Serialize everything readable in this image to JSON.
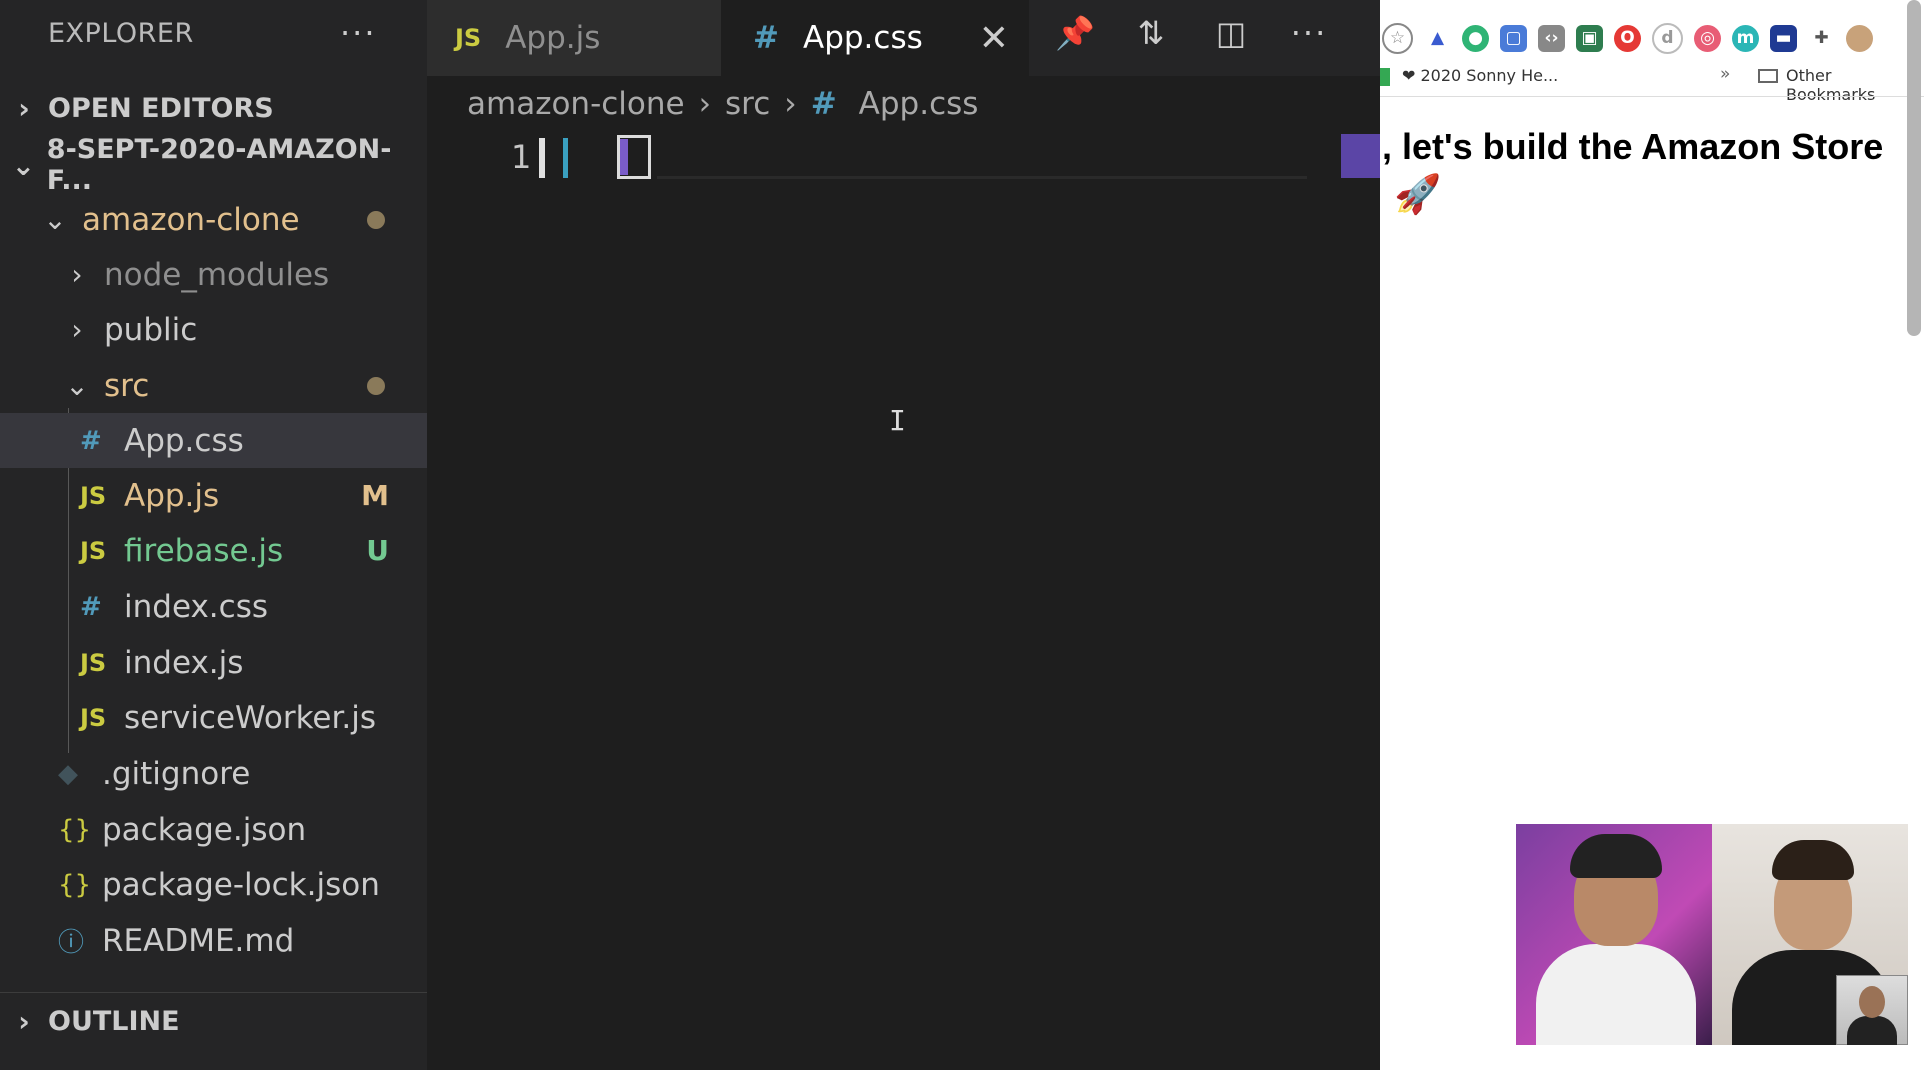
{
  "sidebar": {
    "title": "EXPLORER",
    "more": "···",
    "open_editors": "OPEN EDITORS",
    "project": "8-SEPT-2020-AMAZON-F...",
    "tree": [
      {
        "label": "amazon-clone",
        "type": "folder-open",
        "color": "#e2c08d"
      },
      {
        "label": "node_modules",
        "type": "folder",
        "color": "#8f8f8f"
      },
      {
        "label": "public",
        "type": "folder",
        "color": "#cccccc"
      },
      {
        "label": "src",
        "type": "folder-open",
        "color": "#e2c08d"
      },
      {
        "label": "App.css",
        "type": "css",
        "color": "#cccccc"
      },
      {
        "label": "App.js",
        "type": "js",
        "color": "#e2c08d",
        "badge": "M"
      },
      {
        "label": "firebase.js",
        "type": "js",
        "color": "#73c991",
        "badge": "U"
      },
      {
        "label": "index.css",
        "type": "css",
        "color": "#cccccc"
      },
      {
        "label": "index.js",
        "type": "js",
        "color": "#cccccc"
      },
      {
        "label": "serviceWorker.js",
        "type": "js",
        "color": "#cccccc"
      },
      {
        "label": ".gitignore",
        "type": "git",
        "color": "#cccccc"
      },
      {
        "label": "package.json",
        "type": "json",
        "color": "#cccccc"
      },
      {
        "label": "package-lock.json",
        "type": "json",
        "color": "#cccccc"
      },
      {
        "label": "README.md",
        "type": "info",
        "color": "#cccccc"
      }
    ],
    "outline": "OUTLINE"
  },
  "editor": {
    "tabs": [
      {
        "label": "App.js",
        "icon": "JS",
        "active": false
      },
      {
        "label": "App.css",
        "icon": "#",
        "active": true
      }
    ],
    "breadcrumb": [
      "amazon-clone",
      "src",
      "App.css"
    ],
    "line_number": "1"
  },
  "browser": {
    "bookmark": "❤ 2020 Sonny He...",
    "bookmark_more": "»",
    "other_bookmarks": "Other Bookmarks",
    "headline": ", let's build the Amazon Store",
    "rocket": "🚀"
  }
}
